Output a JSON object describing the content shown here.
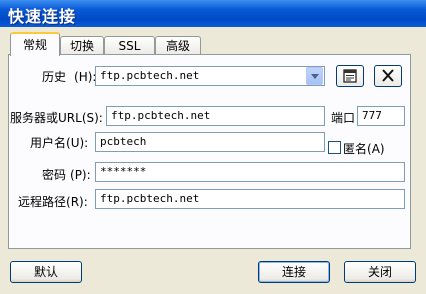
{
  "window": {
    "title": "快速连接"
  },
  "tabs": [
    "常规",
    "切换",
    "SSL",
    "高级"
  ],
  "form": {
    "history_label": "历史",
    "history_mnemonic": "(H):",
    "history_value": "ftp.pcbtech.net",
    "server_label": "服务器或URL",
    "server_mnemonic": "(S):",
    "server_value": "ftp.pcbtech.net",
    "port_label": "端口",
    "port_value": "777",
    "username_label": "用户名",
    "username_mnemonic": "(U):",
    "username_value": "pcbtech",
    "anonymous_label": "匿名",
    "anonymous_mnemonic": "(A)",
    "password_label": "密码",
    "password_mnemonic": "(P):",
    "password_value": "*******",
    "remote_path_label": "远程路径",
    "remote_path_mnemonic": "(R):",
    "remote_path_value": "ftp.pcbtech.net"
  },
  "buttons": {
    "default": "默认",
    "connect": "连接",
    "close": "关闭"
  },
  "icons": {
    "history_details": "document-icon",
    "history_delete": "close-x-icon"
  }
}
